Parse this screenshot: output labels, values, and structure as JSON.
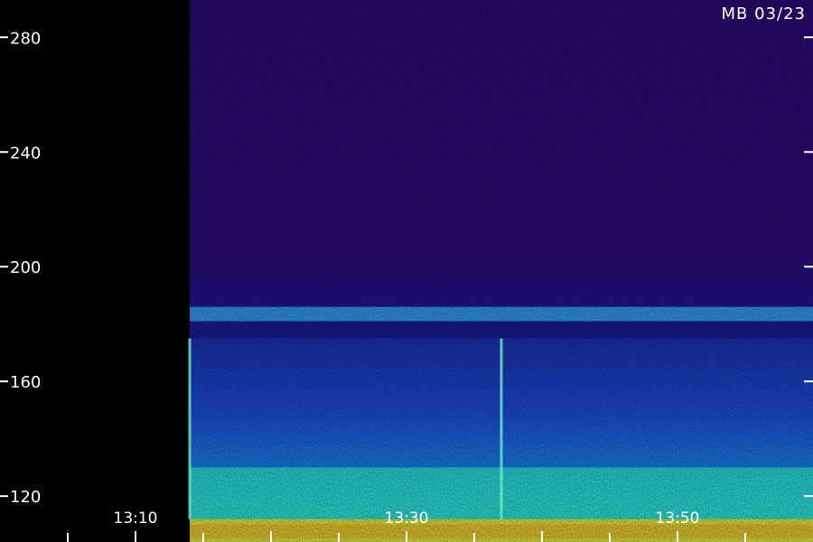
{
  "chart_data": {
    "type": "heatmap",
    "title": "MB 03/23",
    "xlabel": "",
    "ylabel": "",
    "y_ticks": [
      120,
      160,
      200,
      240,
      280
    ],
    "ylim": [
      104,
      293
    ],
    "x_ticks": [
      "13:10",
      "13:30",
      "13:50"
    ],
    "xlim": [
      "13:00",
      "14:00"
    ],
    "data_start": "13:14",
    "bands": [
      {
        "y_range": [
          104,
          112
        ],
        "intensity": "very high"
      },
      {
        "y_range": [
          112,
          130
        ],
        "intensity": "high"
      },
      {
        "y_range": [
          130,
          175
        ],
        "intensity": "medium"
      },
      {
        "y_range": [
          181,
          186
        ],
        "intensity": "medium-high"
      },
      {
        "y_range": [
          186,
          293
        ],
        "intensity": "low"
      }
    ],
    "spikes": [
      {
        "time": "13:14",
        "y_range": [
          112,
          175
        ]
      },
      {
        "time": "13:37",
        "y_range": [
          112,
          175
        ]
      }
    ],
    "grid": false,
    "legend": "none"
  }
}
